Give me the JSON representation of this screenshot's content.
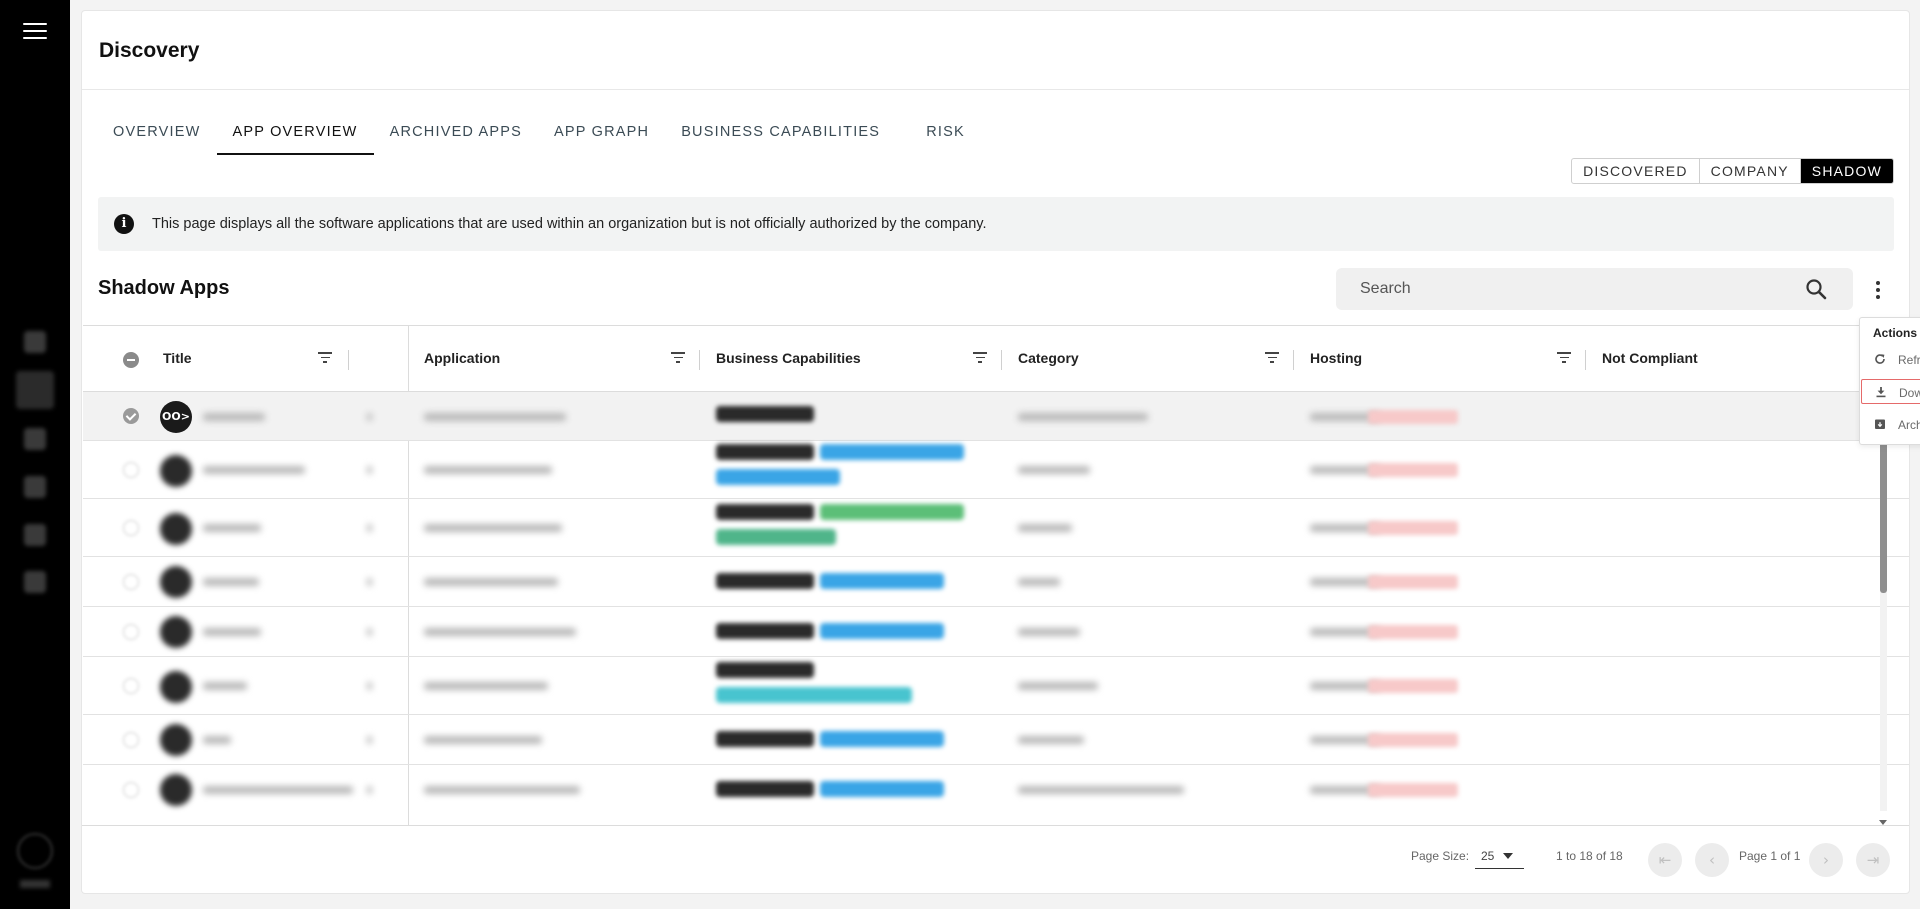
{
  "page": {
    "title": "Discovery"
  },
  "tabs": [
    "OVERVIEW",
    "APP OVERVIEW",
    "ARCHIVED APPS",
    "APP GRAPH",
    "BUSINESS CAPABILITIES",
    "RISK"
  ],
  "active_tab": "APP OVERVIEW",
  "segment": {
    "options": [
      "DISCOVERED",
      "COMPANY",
      "SHADOW"
    ],
    "selected": "SHADOW"
  },
  "info_banner": {
    "text": "This page displays all the software applications that are used within an organization but is not officially authorized by the company."
  },
  "section": {
    "title": "Shadow Apps"
  },
  "search": {
    "placeholder": "Search"
  },
  "table": {
    "columns": [
      "Title",
      "Application",
      "Business Capabilities",
      "Category",
      "Hosting",
      "Not Compliant"
    ],
    "first_row_logo": "OO>"
  },
  "actions_menu": {
    "title": "Actions",
    "items": [
      {
        "label": "Refresh",
        "icon": "refresh-icon"
      },
      {
        "label": "Download",
        "icon": "download-icon",
        "highlighted": true
      },
      {
        "label": "Archive",
        "icon": "archive-icon"
      }
    ]
  },
  "pagination": {
    "page_size_label": "Page Size:",
    "page_size": "25",
    "range_text": "1 to 18 of 18",
    "page_text": "Page 1 of 1"
  },
  "colors": {
    "accent": "#000000",
    "highlight_border": "#e56a6a",
    "capability_blue": "#3aa5e6"
  }
}
